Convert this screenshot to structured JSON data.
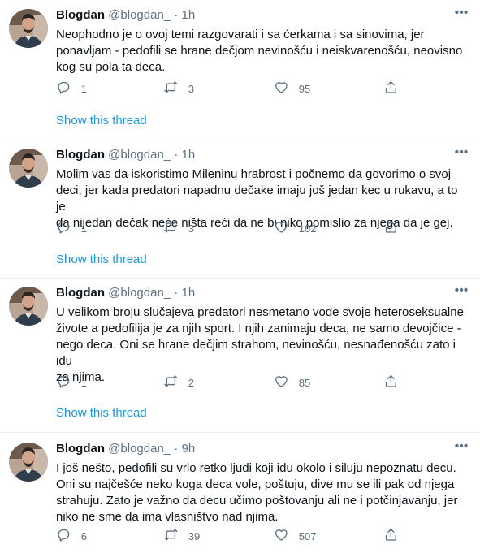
{
  "tweets": [
    {
      "name": "Blogdan",
      "handle": "@blogdan_",
      "dot": "·",
      "time": "1h",
      "lines": [
        "Neophodno je o ovoj temi razgovarati i sa ćerkama i sa sinovima, jer",
        "ponavljam - pedofili se hrane dečjom nevinošću i neiskvarenošću, neovisno",
        "kog su pola ta deca."
      ],
      "replies": "1",
      "retweets": "3",
      "likes": "95",
      "show_thread": "Show this thread"
    },
    {
      "name": "Blogdan",
      "handle": "@blogdan_",
      "dot": "·",
      "time": "1h",
      "lines": [
        "Molim vas da iskoristimo Mileninu hrabrost i počnemo da govorimo o svoj",
        "deci, jer kada predatori napadnu dečake imaju još jedan kec u rukavu, a to je",
        "da nijedan dečak neće ništa reći da ne bi niko pomislio za njega da je gej."
      ],
      "replies": "1",
      "retweets": "3",
      "likes": "102",
      "show_thread": "Show this thread"
    },
    {
      "name": "Blogdan",
      "handle": "@blogdan_",
      "dot": "·",
      "time": "1h",
      "lines": [
        "U velikom broju slučajeva predatori nesmetano vode svoje heteroseksualne",
        "živote a pedofilija je za njih sport. I njih zanimaju deca, ne samo devojčice -",
        "nego deca. Oni se hrane dečjim strahom, nevinošću, nesnađenošću zato i idu",
        "za njima."
      ],
      "replies": "1",
      "retweets": "2",
      "likes": "85",
      "show_thread": "Show this thread"
    },
    {
      "name": "Blogdan",
      "handle": "@blogdan_",
      "dot": "·",
      "time": "9h",
      "lines": [
        "I još nešto, pedofili su vrlo retko ljudi koji idu okolo i siluju nepoznatu decu.",
        "Oni su najčešće neko koga deca vole, poštuju, dive mu se ili pak od njega",
        "strahuju. Zato je važno da decu učimo poštovanju ali ne i potčinjavanju, jer",
        "niko ne sme da ima vlasništvo nad njima."
      ],
      "replies": "6",
      "retweets": "39",
      "likes": "507",
      "show_thread": ""
    }
  ],
  "icons": {
    "reply": "reply-icon",
    "retweet": "retweet-icon",
    "like": "heart-icon",
    "share": "share-icon",
    "more": "more-icon"
  },
  "colors": {
    "link": "#1b95e0",
    "secondary": "#5b7083",
    "text": "#0f1419",
    "separator": "#ebeef0"
  }
}
